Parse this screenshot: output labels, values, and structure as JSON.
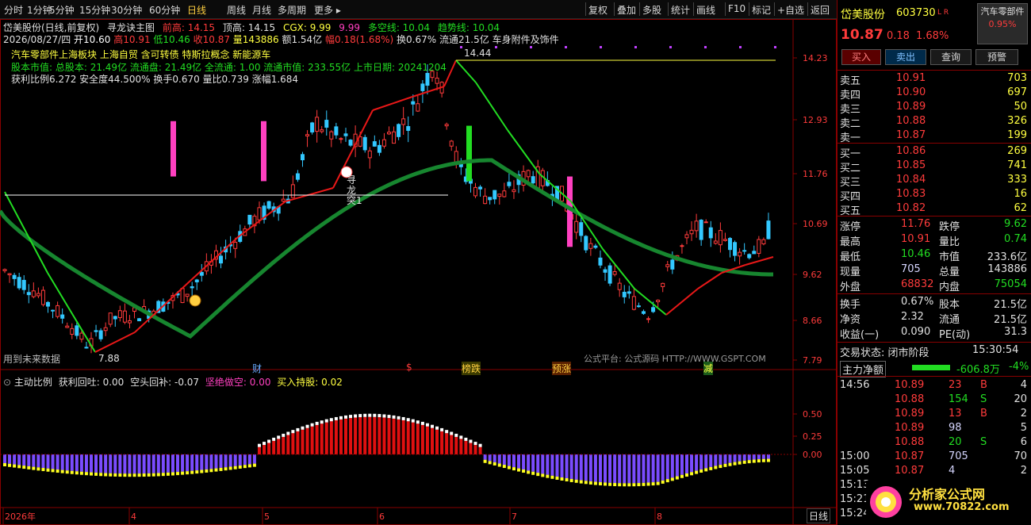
{
  "toolbar": {
    "periods": [
      "分时",
      "1分钟",
      "5分钟",
      "15分钟",
      "30分钟",
      "60分钟",
      "日线",
      "周线",
      "月线",
      "多周期",
      "更多"
    ],
    "active_period": "日线",
    "right_items": [
      "复权",
      "叠加",
      "多股",
      "统计",
      "画线",
      "F10",
      "标记",
      "+自选",
      "返回"
    ]
  },
  "overlay": {
    "stock_line": "岱美股份(日线,前复权)",
    "indicator_name": "寻龙诀主图",
    "high_label": "前高: 14.15",
    "top_label": "顶高: 14.15",
    "cgx": "CGX: 9.99",
    "cgx2": "9.99",
    "dkx": "多空线: 10.04",
    "qsx": "趋势线: 10.04",
    "date_line": "2026/08/27/四",
    "ohlc": {
      "open": "开10.60",
      "high": "高10.91",
      "low": "低10.46",
      "close": "收10.87",
      "vol": "量143886",
      "amt": "额1.54亿",
      "amp": "幅0.18(1.68%)",
      "turn": "换0.67%",
      "float": "流通21.5亿",
      "industry": "车身附件及饰件"
    },
    "concepts": "汽车零部件上海板块 上海自贸 含可转债 特斯拉概念 新能源车",
    "capital": "股本市值: 总股本: 21.49亿 流通盘: 21.49亿 全流通: 1.00 流通市值: 233.55亿 上市日期: 20241204",
    "ratios": "获利比例6.272 安全度44.500% 换手0.670 量比0.739 涨幅1.684",
    "peak_label": "14.44",
    "low_label": "7.88",
    "xunlong_label": [
      "寻",
      "龙",
      "突1"
    ],
    "future_note": "用到未来数据",
    "watermark_src": "公式平台: 公式源码 HTTP://WWW.GSPT.COM",
    "watermark": "分析家公式网 www.70822.com",
    "events": [
      "财",
      "$",
      "榜跌",
      "预涨",
      "减"
    ],
    "sub_indicator": {
      "name": "主动比例",
      "a": "获利回吐: 0.00",
      "b": "空头回补: -0.07",
      "c": "坚绝做空: 0.00",
      "d": "买入持股: 0.02"
    },
    "bottom_tab": "日线"
  },
  "y_axis_main": [
    "14.23",
    "12.93",
    "11.76",
    "10.69",
    "9.62",
    "8.66",
    "7.79"
  ],
  "y_axis_sub": [
    "0.50",
    "0.25",
    "0.00"
  ],
  "x_axis": [
    "2026年",
    "4",
    "5",
    "6",
    "7",
    "8"
  ],
  "quote": {
    "name": "岱美股份",
    "code": "603730",
    "flags": "L R",
    "sector_tag": "汽车零部件",
    "sector_pct": "0.95%",
    "price": "10.87",
    "change": "0.18",
    "change_pct": "1.68%",
    "buttons": [
      "买入",
      "卖出",
      "查询",
      "预警"
    ],
    "asks": [
      {
        "label": "卖五",
        "price": "10.91",
        "vol": "703"
      },
      {
        "label": "卖四",
        "price": "10.90",
        "vol": "697"
      },
      {
        "label": "卖三",
        "price": "10.89",
        "vol": "50"
      },
      {
        "label": "卖二",
        "price": "10.88",
        "vol": "326"
      },
      {
        "label": "卖一",
        "price": "10.87",
        "vol": "199"
      }
    ],
    "bids": [
      {
        "label": "买一",
        "price": "10.86",
        "vol": "269"
      },
      {
        "label": "买二",
        "price": "10.85",
        "vol": "741"
      },
      {
        "label": "买三",
        "price": "10.84",
        "vol": "333"
      },
      {
        "label": "买四",
        "price": "10.83",
        "vol": "16"
      },
      {
        "label": "买五",
        "price": "10.82",
        "vol": "62"
      }
    ],
    "stats": [
      {
        "l1": "涨停",
        "v1": "11.76",
        "c1": "#ff3b3b",
        "l2": "跌停",
        "v2": "9.62",
        "c2": "#22dd22"
      },
      {
        "l1": "最高",
        "v1": "10.91",
        "c1": "#ff3b3b",
        "l2": "量比",
        "v2": "0.74",
        "c2": "#22dd22"
      },
      {
        "l1": "最低",
        "v1": "10.46",
        "c1": "#22dd22",
        "l2": "市值",
        "v2": "233.6亿",
        "c2": "#e0e0e0"
      },
      {
        "l1": "现量",
        "v1": "705",
        "c1": "#d6d6ff",
        "l2": "总量",
        "v2": "143886",
        "c2": "#e0e0e0"
      },
      {
        "l1": "外盘",
        "v1": "68832",
        "c1": "#ff3b3b",
        "l2": "内盘",
        "v2": "75054",
        "c2": "#22dd22"
      }
    ],
    "stats2": [
      {
        "l1": "换手",
        "v1": "0.67%",
        "l2": "股本",
        "v2": "21.5亿"
      },
      {
        "l1": "净资",
        "v1": "2.32",
        "l2": "流通",
        "v2": "21.5亿"
      },
      {
        "l1": "收益(一)",
        "v1": "0.090",
        "l2": "PE(动)",
        "v2": "31.3"
      }
    ],
    "trade_status": "交易状态: 闭市阶段",
    "trade_time": "15:30:54",
    "main_flow_label": "主力净额",
    "main_flow_value": "-606.8万",
    "main_flow_pct": "-4%",
    "ticks": [
      {
        "t": "14:56",
        "p": "10.89",
        "v": "23",
        "s": "B",
        "n": "4"
      },
      {
        "t": "",
        "p": "10.88",
        "v": "154",
        "s": "S",
        "n": "20"
      },
      {
        "t": "",
        "p": "10.89",
        "v": "13",
        "s": "B",
        "n": "2"
      },
      {
        "t": "",
        "p": "10.89",
        "v": "98",
        "s": "",
        "n": "5"
      },
      {
        "t": "",
        "p": "10.88",
        "v": "20",
        "s": "S",
        "n": "6"
      },
      {
        "t": "15:00",
        "p": "10.87",
        "v": "705",
        "s": "",
        "n": "70"
      },
      {
        "t": "15:05",
        "p": "10.87",
        "v": "4",
        "s": "",
        "n": "2"
      },
      {
        "t": "15:13",
        "p": "",
        "v": "",
        "s": "",
        "n": ""
      },
      {
        "t": "15:21",
        "p": "",
        "v": "",
        "s": "",
        "n": ""
      },
      {
        "t": "15:24",
        "p": "",
        "v": "",
        "s": "",
        "n": ""
      }
    ],
    "logo_text": "分析家公式网",
    "logo_url": "www.70822.com"
  },
  "colors": {
    "up": "#ff3b3b",
    "down": "#22dd22",
    "candle_up": "#ff3b3b",
    "candle_down": "#33c8ff",
    "ma_red": "#e81818",
    "ma_green": "#22dd22",
    "trend": "#17862f",
    "pink": "#ff40c0"
  }
}
